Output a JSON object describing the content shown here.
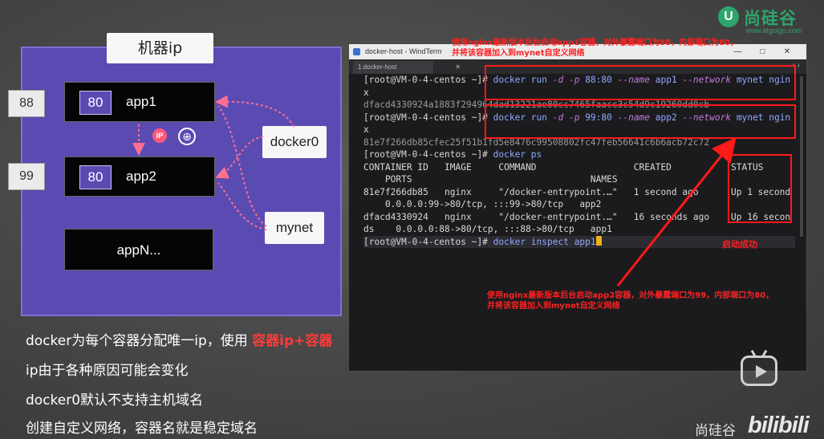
{
  "diagram": {
    "machine_title": "机器ip",
    "apps": [
      {
        "ext_port": "88",
        "int_port": "80",
        "name": "app1"
      },
      {
        "ext_port": "99",
        "int_port": "80",
        "name": "app2"
      }
    ],
    "appn": "appN...",
    "networks": [
      "docker0",
      "mynet"
    ],
    "ip_icon": "IP"
  },
  "bullets": [
    {
      "text": "docker为每个容器分配唯一ip，使用 ",
      "highlight": "容器ip+容器"
    },
    {
      "text": "ip由于各种原因可能会变化"
    },
    {
      "text": "docker0默认不支持主机域名"
    },
    {
      "text": "创建自定义网络，容器名就是稳定域名"
    }
  ],
  "window": {
    "title": "docker-host - WindTerm",
    "tab": "1.docker-host",
    "controls": {
      "minimize": "—",
      "maximize": "□",
      "close": "✕"
    }
  },
  "terminal": {
    "prompt": "[root@VM-0-4-centos ~]# ",
    "cmd1": {
      "docker": "docker run ",
      "d": "-d",
      "p": " -p",
      "port": " 88:80 ",
      "name": "--name",
      "app": " app1 ",
      "net": "--network",
      "rest": " mynet ngin"
    },
    "cmd1_wrap": "x",
    "cmd1_out": "dfacd4330924a1883f294964dad13221ae80cc7465faacc3c54d9c19260dd0cb",
    "cmd2": {
      "docker": "docker run ",
      "d": "-d",
      "p": " -p",
      "port": " 99:80 ",
      "name": "--name",
      "app": " app2 ",
      "net": "--network",
      "rest": " mynet ngin"
    },
    "cmd2_wrap": "x",
    "cmd2_out": "81e7f266db85cfec25f51b1fd5e8476c99508802fc47feb56641c6b6acb72c72",
    "cmd3": "docker ps",
    "ps_header1": "CONTAINER ID   IMAGE     COMMAND                  CREATED           STATUS",
    "ps_header2": "    PORTS                                 NAMES",
    "row1a": "81e7f266db85   nginx     \"/docker-entrypoint.…\"   1 second ago      Up 1 second",
    "row1b": "    0.0.0.0:99->80/tcp, :::99->80/tcp   app2",
    "row2a": "dfacd4330924   nginx     \"/docker-entrypoint.…\"   16 seconds ago    Up 16 secon",
    "row2b": "ds    0.0.0.0:88->80/tcp, :::88->80/tcp   app1",
    "cmd4": "docker inspect app1"
  },
  "annotations": {
    "top_line1": "使用nginx最新版本后台启动app1容器，对外暴露端口为88，内部端口为80，",
    "top_line2": "并将该容器加入到mynet自定义网络",
    "bottom_line1": "使用nginx最新版本后台启动app2容器，对外暴露端口为99，内部端口为80，",
    "bottom_line2": "并将该容器加入到mynet自定义网络",
    "success": "启动成功"
  },
  "brand": {
    "logo_letter": "U",
    "logo_cn": "尚硅谷",
    "logo_url": "www.atguigu.com",
    "footer_cn": "尚硅谷",
    "footer_bili": "bilibili"
  },
  "colors": {
    "accent_purple": "#5a4bb3",
    "annotation_red": "#ff1a1a",
    "brand_green": "#2ea56b"
  }
}
